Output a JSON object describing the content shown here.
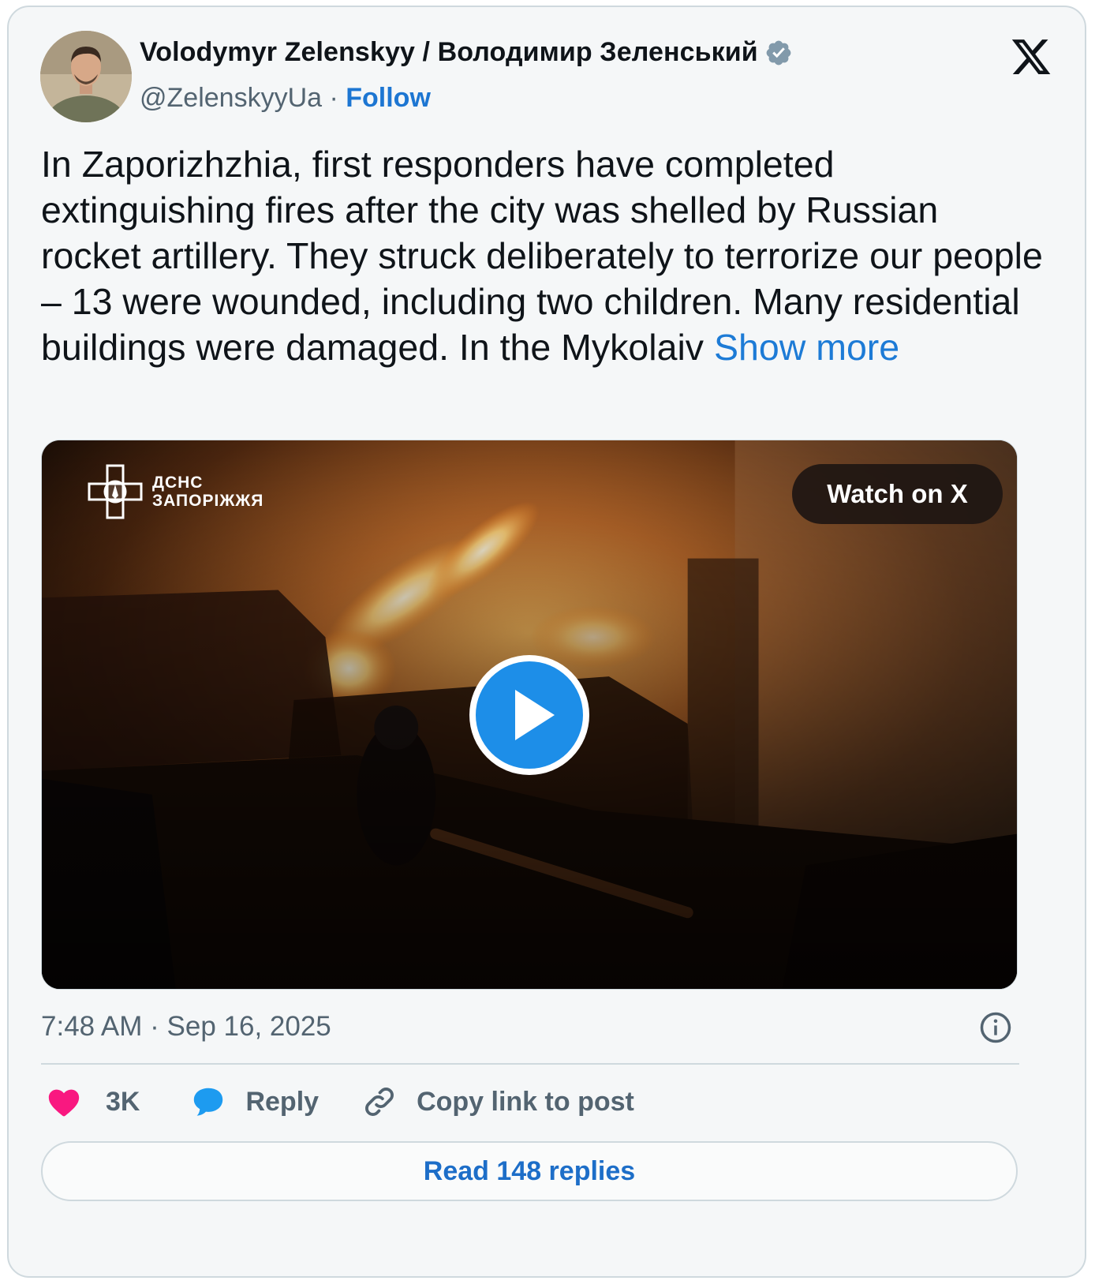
{
  "post": {
    "author_name": "Volodymyr Zelenskyy / Володимир Зеленський",
    "handle": "@ZelenskyyUa",
    "separator": " · ",
    "follow_label": "Follow",
    "verified": true,
    "text": "In Zaporizhzhia, first responders have completed extinguishing fires after the city was shelled by Russian rocket artillery. They struck deliberately to terrorize our people – 13 were wounded, including two children. Many residential buildings were damaged. In the Mykolaiv",
    "show_more_label": "Show more",
    "timestamp": "7:48 AM · Sep 16, 2025"
  },
  "media": {
    "type": "video",
    "watermark_line1": "ДСНС",
    "watermark_line2": "ЗАПОРІЖЖЯ",
    "watch_label": "Watch on X",
    "play_icon": "play-icon"
  },
  "actions": {
    "like_count": "3K",
    "reply_label": "Reply",
    "copy_link_label": "Copy link to post"
  },
  "footer": {
    "read_replies_label": "Read 148 replies"
  },
  "colors": {
    "link": "#1d76d2",
    "like": "#f91880",
    "reply_icon": "#1d9bf0",
    "verified_badge": "#829aab",
    "border": "#cfd9de"
  },
  "icons": [
    "verified-badge-icon",
    "x-logo-icon",
    "info-icon",
    "heart-icon",
    "reply-bubble-icon",
    "link-icon"
  ]
}
